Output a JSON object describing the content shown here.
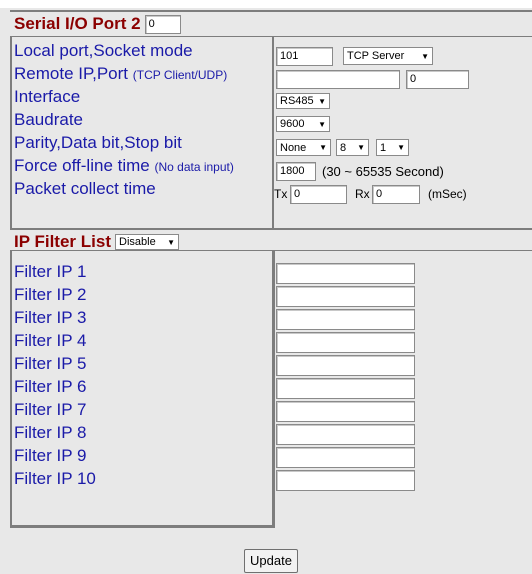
{
  "serial": {
    "title": "Serial I/O Port 2",
    "port_index": "0"
  },
  "settings": {
    "local_port": {
      "label": "Local port,Socket mode",
      "port_value": "101",
      "mode": "TCP Server"
    },
    "remote": {
      "label": "Remote IP,Port",
      "label_hint": "(TCP Client/UDP)",
      "ip_value": "",
      "port_value": "0"
    },
    "interface": {
      "label": "Interface",
      "value": "RS485"
    },
    "baudrate": {
      "label": "Baudrate",
      "value": "9600"
    },
    "parity": {
      "label": "Parity,Data bit,Stop bit",
      "parity_value": "None",
      "data_bits": "8",
      "stop_bits": "1"
    },
    "offline": {
      "label": "Force off-line time",
      "label_hint": "(No data input)",
      "value": "1800",
      "range_note": "(30 ~ 65535 Second)"
    },
    "packet": {
      "label": "Packet collect time",
      "tx_label": "Tx",
      "tx_value": "0",
      "rx_label": "Rx",
      "rx_value": "0",
      "unit": "(mSec)"
    }
  },
  "ip_filter": {
    "title": "IP Filter List",
    "mode": "Disable",
    "items": [
      {
        "label": "Filter IP 1",
        "value": ""
      },
      {
        "label": "Filter IP 2",
        "value": ""
      },
      {
        "label": "Filter IP 3",
        "value": ""
      },
      {
        "label": "Filter IP 4",
        "value": ""
      },
      {
        "label": "Filter IP 5",
        "value": ""
      },
      {
        "label": "Filter IP 6",
        "value": ""
      },
      {
        "label": "Filter IP 7",
        "value": ""
      },
      {
        "label": "Filter IP 8",
        "value": ""
      },
      {
        "label": "Filter IP 9",
        "value": ""
      },
      {
        "label": "Filter IP 10",
        "value": ""
      }
    ]
  },
  "actions": {
    "update_label": "Update"
  },
  "colors": {
    "background": "#e8e8e8",
    "label_blue": "#1a1aa8",
    "header_red": "#8b0000",
    "border_gray": "#7d7d7d"
  },
  "icons": {
    "dropdown": "triangle-down-icon"
  }
}
